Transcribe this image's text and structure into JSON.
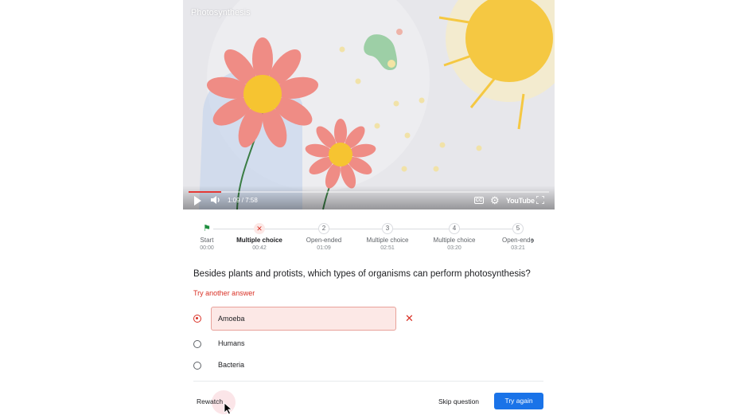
{
  "video": {
    "title": "Photosynthesis",
    "time_display": "1:09 / 7:58",
    "progress_fraction": 0.09,
    "brand_label": "YouTube",
    "cc_label": "CC"
  },
  "timeline": {
    "steps": [
      {
        "label": "Start",
        "time": "00:00",
        "marker": "",
        "status": "start"
      },
      {
        "label": "Multiple choice",
        "time": "00:42",
        "marker": "✕",
        "status": "wrong-current"
      },
      {
        "label": "Open-ended",
        "time": "01:09",
        "marker": "2",
        "status": "upcoming"
      },
      {
        "label": "Multiple choice",
        "time": "02:51",
        "marker": "3",
        "status": "upcoming"
      },
      {
        "label": "Multiple choice",
        "time": "03:20",
        "marker": "4",
        "status": "upcoming"
      },
      {
        "label": "Open-ended",
        "time": "03:21",
        "marker": "5",
        "status": "upcoming"
      }
    ]
  },
  "question": {
    "text": "Besides plants and protists, which types of organisms can perform photosynthesis?",
    "feedback": "Try another answer",
    "options": [
      {
        "label": "Amoeba",
        "selected": true,
        "incorrect": true
      },
      {
        "label": "Humans",
        "selected": false,
        "incorrect": false
      },
      {
        "label": "Bacteria",
        "selected": false,
        "incorrect": false
      }
    ]
  },
  "actions": {
    "rewatch": "Rewatch",
    "skip": "Skip question",
    "try_again": "Try again"
  },
  "colors": {
    "error": "#d93025",
    "primary": "#1a73e8",
    "progress": "#e53935"
  }
}
